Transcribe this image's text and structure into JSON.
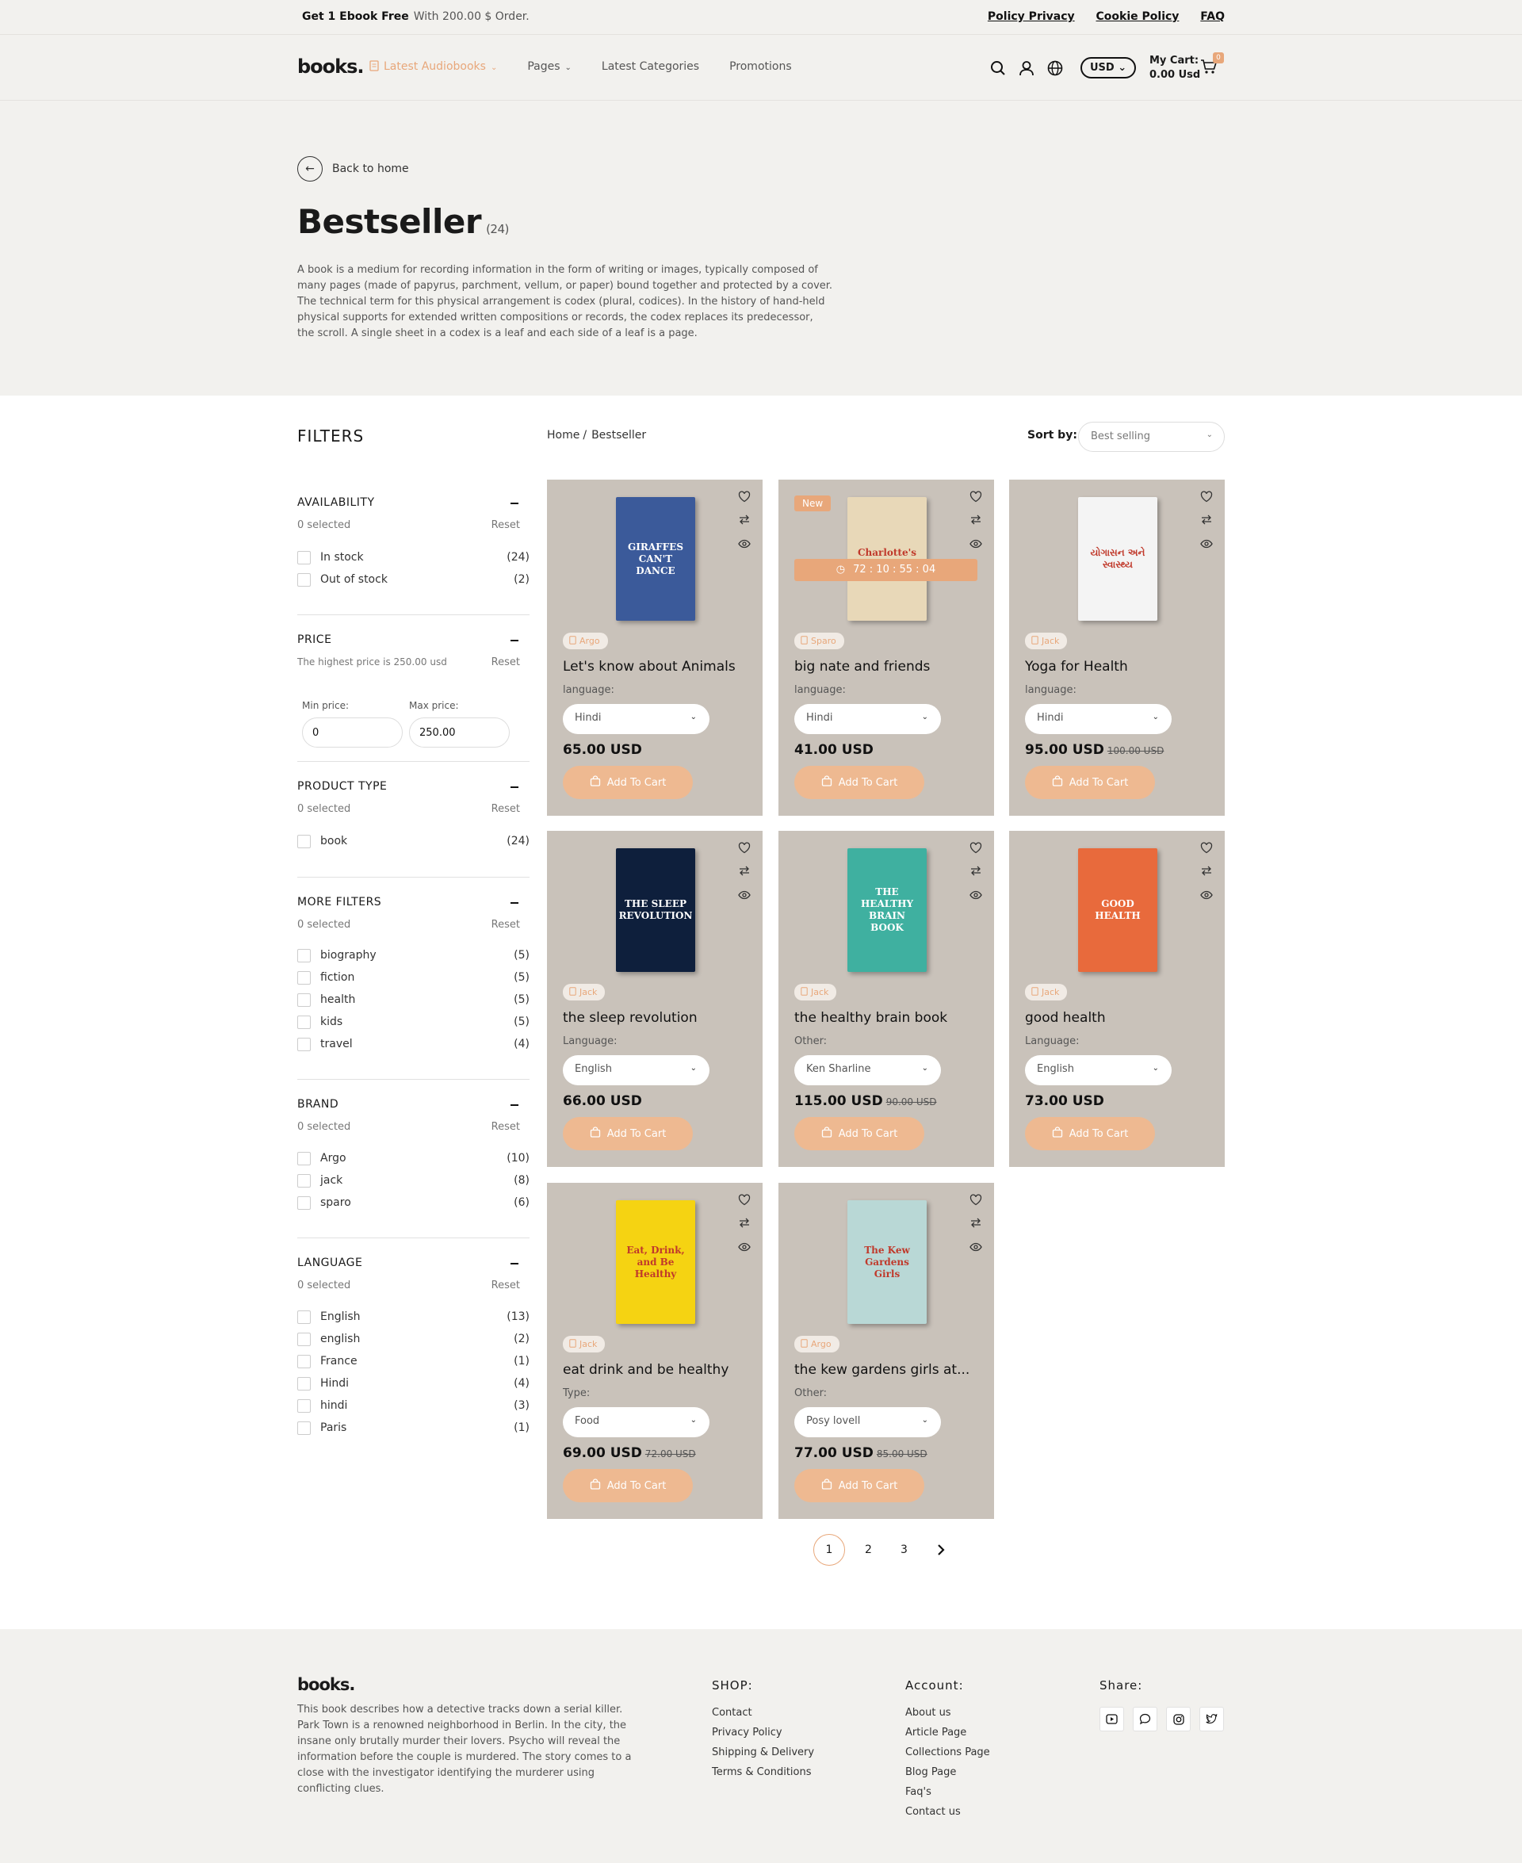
{
  "announcement": {
    "strong": "Get 1 Ebook Free",
    "text": "With 200.00 $ Order.",
    "links": [
      "Policy Privacy",
      "Cookie Policy",
      "FAQ"
    ]
  },
  "header": {
    "logo": "books.",
    "nav": [
      "Latest Audiobooks",
      "Pages",
      "Latest Categories",
      "Promotions"
    ],
    "currency": "USD",
    "cart_label": "My Cart:",
    "cart_total": "0.00 Usd",
    "cart_count": "0"
  },
  "hero": {
    "back": "Back to home",
    "title": "Bestseller",
    "count": "(24)",
    "description": "A book is a medium for recording information in the form of writing or images, typically composed of many pages (made of papyrus, parchment, vellum, or paper) bound together and protected by a cover. The technical term for this physical arrangement is codex (plural, codices). In the history of hand-held physical supports for extended written compositions or records, the codex replaces its predecessor, the scroll. A single sheet in a codex is a leaf and each side of a leaf is a page."
  },
  "filters": {
    "title": "FILTERS",
    "availability": {
      "title": "AVAILABILITY",
      "selected": "0 selected",
      "reset": "Reset",
      "items": [
        {
          "label": "In stock",
          "count": "(24)"
        },
        {
          "label": "Out of stock",
          "count": "(2)"
        }
      ]
    },
    "price": {
      "title": "PRICE",
      "note": "The highest price is 250.00 usd",
      "reset": "Reset",
      "min_label": "Min price:",
      "max_label": "Max price:",
      "min": "0",
      "max": "250.00"
    },
    "product_type": {
      "title": "PRODUCT TYPE",
      "selected": "0 selected",
      "reset": "Reset",
      "items": [
        {
          "label": "book",
          "count": "(24)"
        }
      ]
    },
    "more": {
      "title": "MORE FILTERS",
      "selected": "0 selected",
      "reset": "Reset",
      "items": [
        {
          "label": "biography",
          "count": "(5)"
        },
        {
          "label": "fiction",
          "count": "(5)"
        },
        {
          "label": "health",
          "count": "(5)"
        },
        {
          "label": "kids",
          "count": "(5)"
        },
        {
          "label": "travel",
          "count": "(4)"
        }
      ]
    },
    "brand": {
      "title": "BRAND",
      "selected": "0 selected",
      "reset": "Reset",
      "items": [
        {
          "label": "Argo",
          "count": "(10)"
        },
        {
          "label": "jack",
          "count": "(8)"
        },
        {
          "label": "sparo",
          "count": "(6)"
        }
      ]
    },
    "language": {
      "title": "LANGUAGE",
      "selected": "0 selected",
      "reset": "Reset",
      "items": [
        {
          "label": "English",
          "count": "(13)"
        },
        {
          "label": "english",
          "count": "(2)"
        },
        {
          "label": "France",
          "count": "(1)"
        },
        {
          "label": "Hindi",
          "count": "(4)"
        },
        {
          "label": "hindi",
          "count": "(3)"
        },
        {
          "label": "Paris",
          "count": "(1)"
        }
      ]
    }
  },
  "breadcrumb": {
    "home": "Home",
    "sep": "/",
    "current": "Bestseller"
  },
  "sort": {
    "label": "Sort by:",
    "value": "Best selling"
  },
  "products": [
    {
      "title": "Let's know about Animals",
      "brand": "Argo",
      "opt_label": "language:",
      "opt_value": "Hindi",
      "price": "65.00 USD",
      "old": "",
      "cover": "#3b5a9a",
      "cover_text": "GIRAFFES CAN'T DANCE"
    },
    {
      "title": "big nate and friends",
      "brand": "Sparo",
      "opt_label": "language:",
      "opt_value": "Hindi",
      "price": "41.00 USD",
      "old": "",
      "cover": "#e8d8b8",
      "cover_text": "Charlotte's Web",
      "new": "New",
      "timer": "72 : 10 : 55 : 04"
    },
    {
      "title": "Yoga for Health",
      "brand": "Jack",
      "opt_label": "language:",
      "opt_value": "Hindi",
      "price": "95.00 USD",
      "old": "100.00 USD",
      "cover": "#f4f4f4",
      "cover_text": "યોગાસન અને સ્વાસ્થ્ય"
    },
    {
      "title": "the sleep revolution",
      "brand": "Jack",
      "opt_label": "Language:",
      "opt_value": "English",
      "price": "66.00 USD",
      "old": "",
      "cover": "#0e1f3c",
      "cover_text": "THE SLEEP REVOLUTION"
    },
    {
      "title": "the healthy brain book",
      "brand": "Jack",
      "opt_label": "Other:",
      "opt_value": "Ken Sharline",
      "price": "115.00 USD",
      "old": "90.00 USD",
      "cover": "#3fb0a0",
      "cover_text": "THE HEALTHY BRAIN BOOK"
    },
    {
      "title": "good health",
      "brand": "Jack",
      "opt_label": "Language:",
      "opt_value": "English",
      "price": "73.00 USD",
      "old": "",
      "cover": "#e86a3c",
      "cover_text": "GOOD HEALTH"
    },
    {
      "title": "eat drink and be healthy",
      "brand": "Jack",
      "opt_label": "Type:",
      "opt_value": "Food",
      "price": "69.00 USD",
      "old": "72.00 USD",
      "cover": "#f5d312",
      "cover_text": "Eat, Drink, and Be Healthy"
    },
    {
      "title": "the kew gardens girls at...",
      "brand": "Argo",
      "opt_label": "Other:",
      "opt_value": "Posy lovell",
      "price": "77.00 USD",
      "old": "85.00 USD",
      "cover": "#b9d8d6",
      "cover_text": "The Kew Gardens Girls"
    }
  ],
  "add_to_cart": "Add To Cart",
  "pagination": [
    "1",
    "2",
    "3"
  ],
  "footer": {
    "logo": "books.",
    "description": "This book describes how a detective tracks down a serial killer. Park Town is a renowned neighborhood in Berlin. In the city, the insane only brutally murder their lovers. Psycho will reveal the information before the couple is murdered. The story comes to a close with the investigator identifying the murderer using conflicting clues.",
    "shop_title": "SHOP:",
    "shop": [
      "Contact",
      "Privacy Policy",
      "Shipping & Delivery",
      "Terms & Conditions"
    ],
    "account_title": "Account:",
    "account": [
      "About us",
      "Article Page",
      "Collections Page",
      "Blog Page",
      "Faq's",
      "Contact us"
    ],
    "share_title": "Share:",
    "social_icons": [
      "youtube-icon",
      "chat-icon",
      "instagram-icon",
      "twitter-icon"
    ]
  },
  "colors": {
    "accent": "#e8a77a",
    "card_bg": "#c9c2ba",
    "hero_bg": "#f2f1ee"
  }
}
